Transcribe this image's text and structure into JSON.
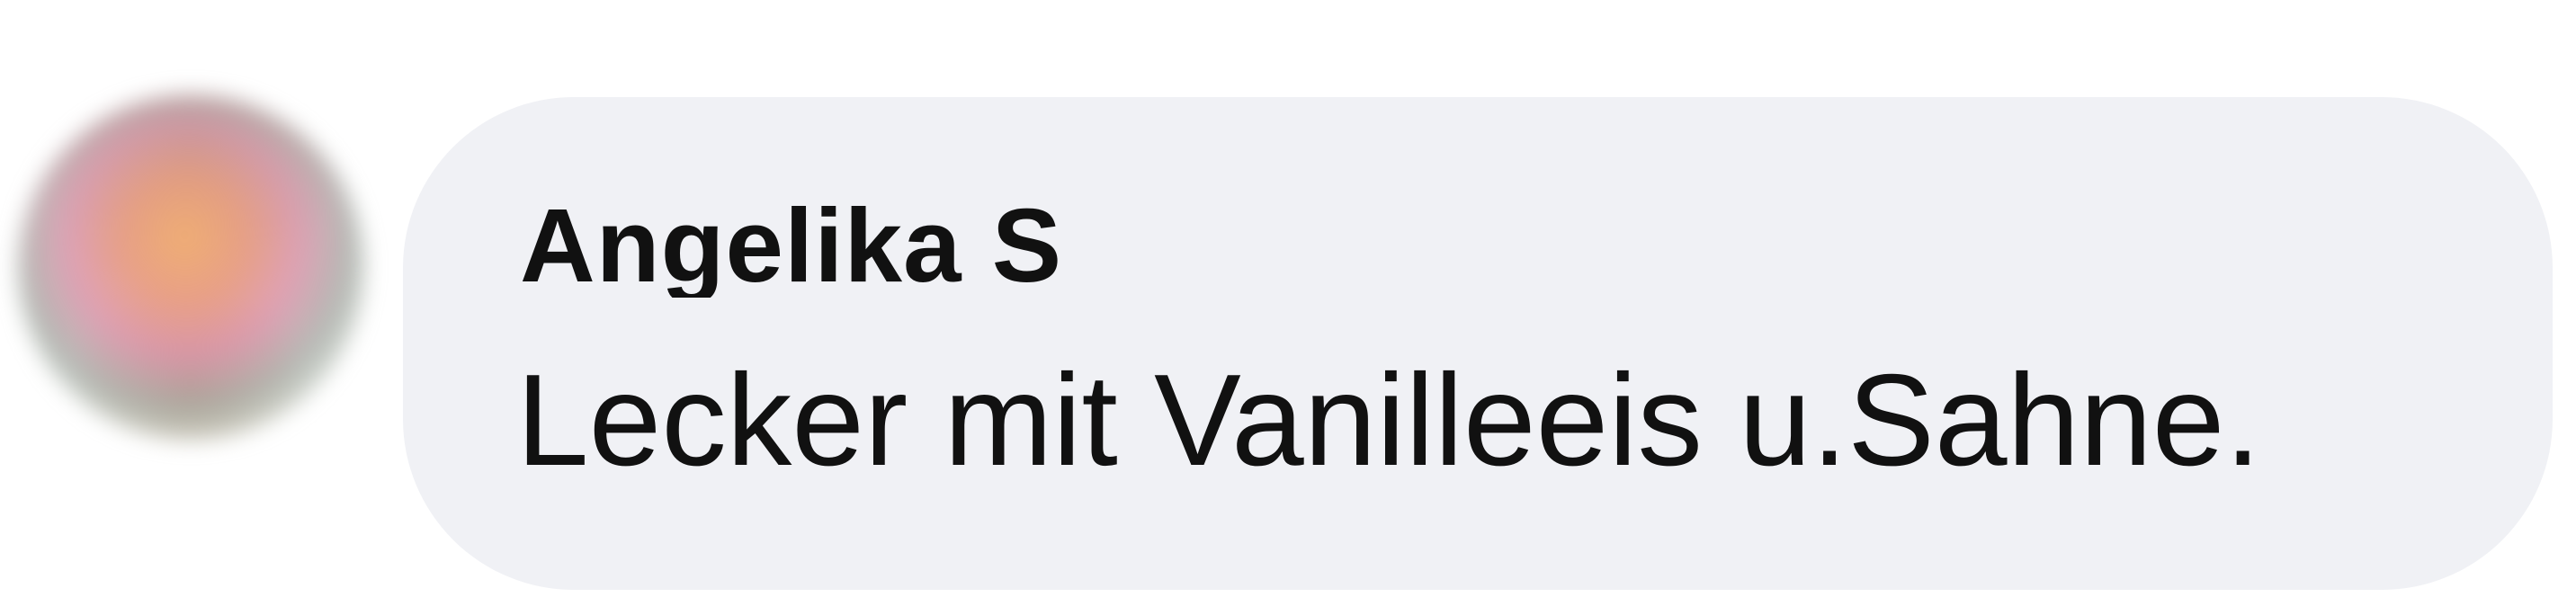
{
  "comment": {
    "author_name": "Angelika S",
    "text": "Lecker mit Vanilleeis u.Sahne."
  },
  "colors": {
    "bubble_background": "#f0f1f5",
    "text": "#111111",
    "page_background": "#ffffff"
  }
}
